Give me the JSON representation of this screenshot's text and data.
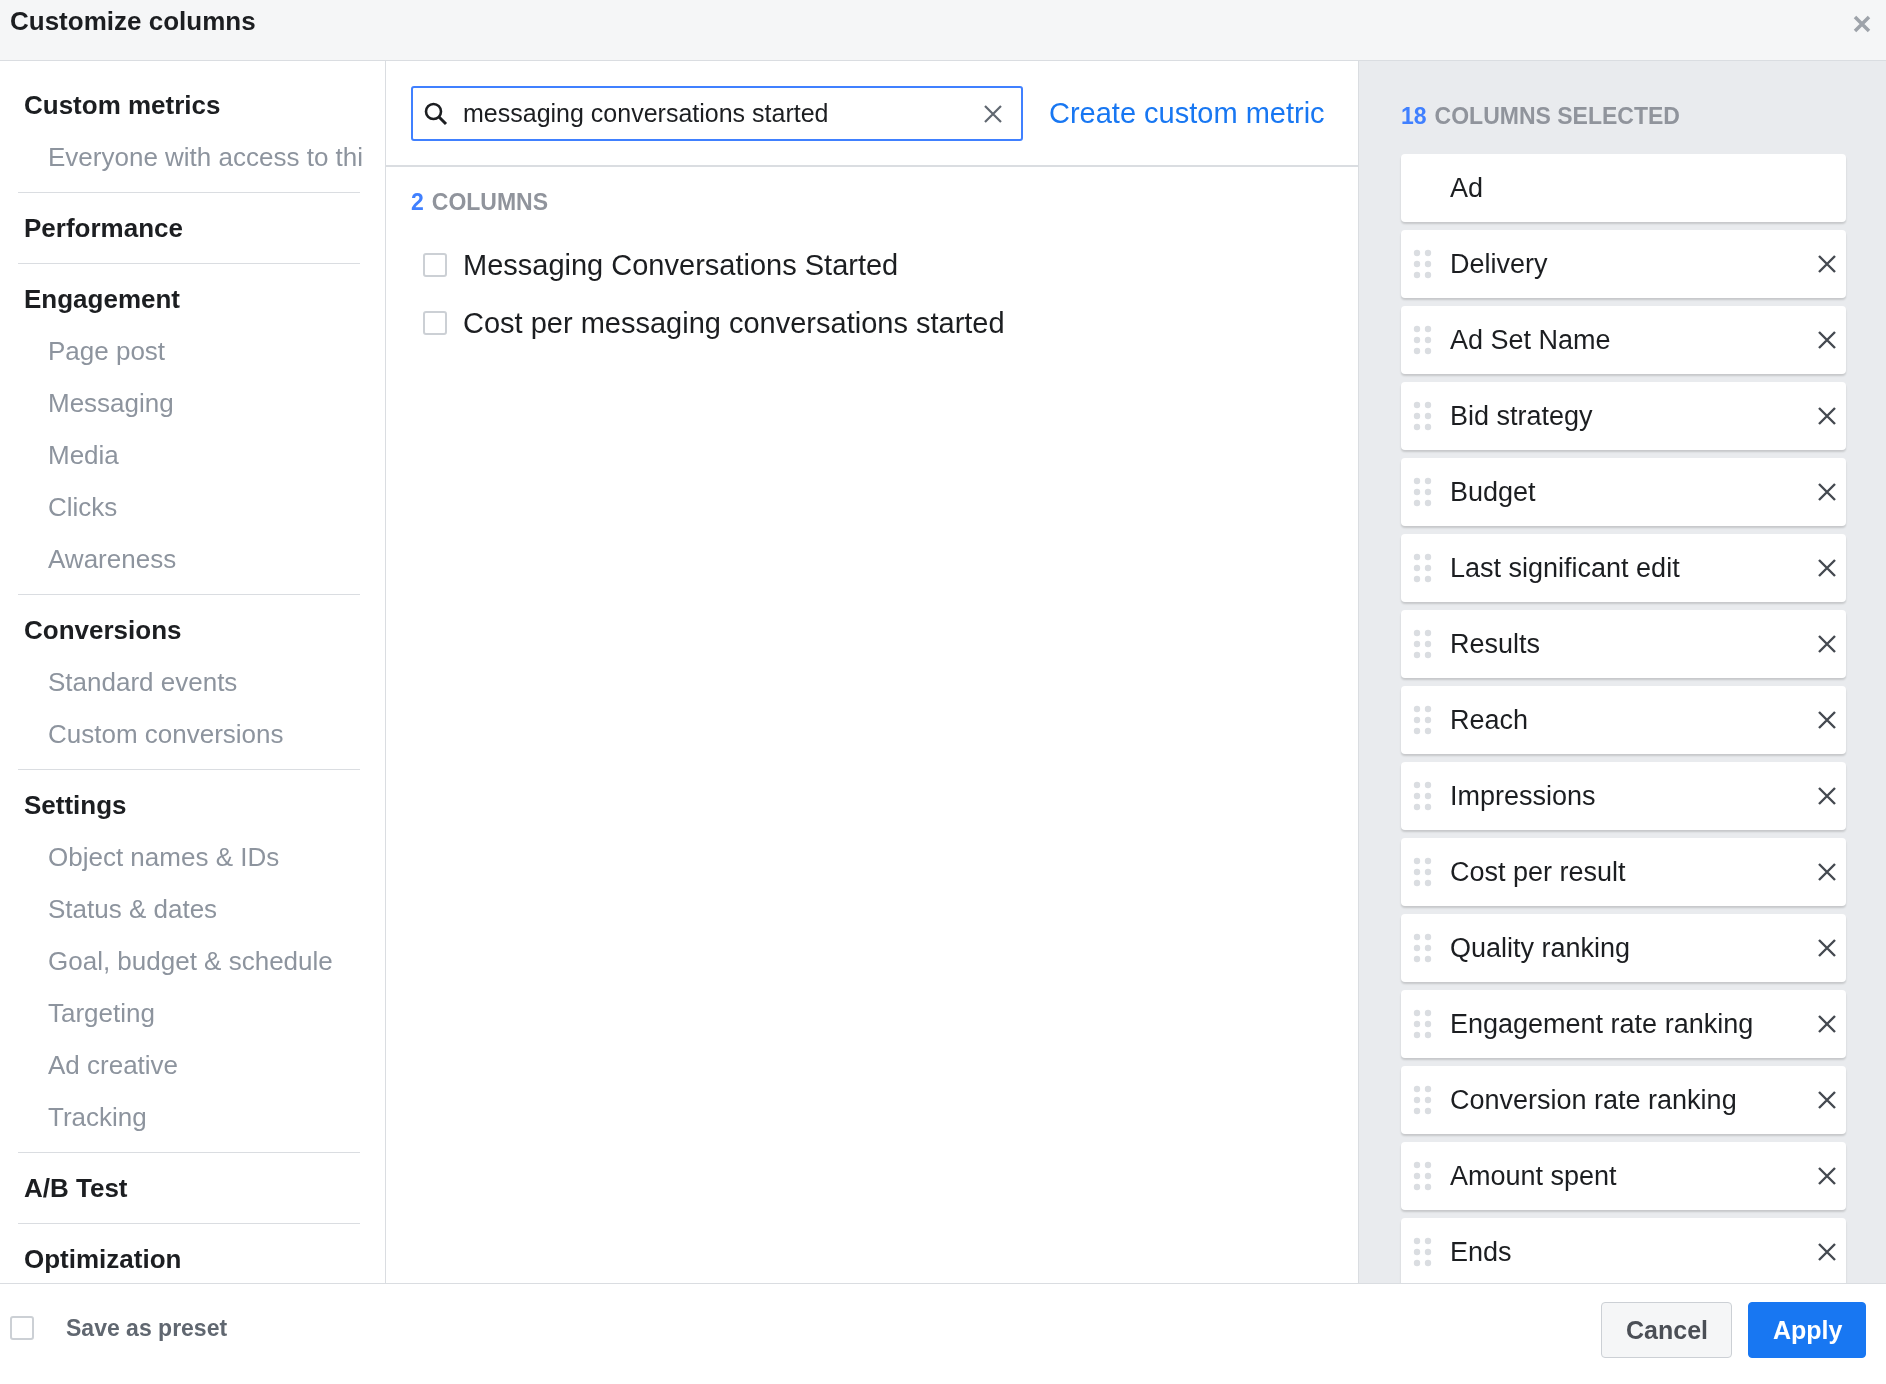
{
  "window": {
    "title": "Customize columns"
  },
  "sidebar": {
    "sections": [
      {
        "title": "Custom metrics",
        "items": [
          "Everyone with access to thi"
        ]
      },
      {
        "title": "Performance"
      },
      {
        "title": "Engagement",
        "items": [
          "Page post",
          "Messaging",
          "Media",
          "Clicks",
          "Awareness"
        ]
      },
      {
        "title": "Conversions",
        "items": [
          "Standard events",
          "Custom conversions"
        ]
      },
      {
        "title": "Settings",
        "items": [
          "Object names & IDs",
          "Status & dates",
          "Goal, budget & schedule",
          "Targeting",
          "Ad creative",
          "Tracking"
        ]
      },
      {
        "title": "A/B Test"
      },
      {
        "title": "Optimization"
      }
    ]
  },
  "search": {
    "value": "messaging conversations started",
    "link": "Create custom metric"
  },
  "results": {
    "count": "2",
    "heading": "COLUMNS",
    "rows": [
      {
        "label": "Messaging Conversations Started",
        "checked": false
      },
      {
        "label": "Cost per messaging conversations started",
        "checked": false
      }
    ]
  },
  "selected": {
    "count": "18",
    "heading": "COLUMNS SELECTED",
    "columns": [
      {
        "label": "Ad",
        "kind": "fixed"
      },
      {
        "label": "Delivery",
        "kind": "movable"
      },
      {
        "label": "Ad Set Name",
        "kind": "movable"
      },
      {
        "label": "Bid strategy",
        "kind": "movable"
      },
      {
        "label": "Budget",
        "kind": "movable"
      },
      {
        "label": "Last significant edit",
        "kind": "movable"
      },
      {
        "label": "Results",
        "kind": "movable"
      },
      {
        "label": "Reach",
        "kind": "movable"
      },
      {
        "label": "Impressions",
        "kind": "movable"
      },
      {
        "label": "Cost per result",
        "kind": "movable"
      },
      {
        "label": "Quality ranking",
        "kind": "movable"
      },
      {
        "label": "Engagement rate ranking",
        "kind": "movable"
      },
      {
        "label": "Conversion rate ranking",
        "kind": "movable"
      },
      {
        "label": "Amount spent",
        "kind": "movable"
      },
      {
        "label": "Ends",
        "kind": "movable"
      }
    ]
  },
  "footer": {
    "save_preset": {
      "label": "Save as preset",
      "checked": false
    },
    "buttons": [
      {
        "label": "Cancel",
        "kind": "secondary"
      },
      {
        "label": "Apply",
        "kind": "primary"
      }
    ]
  }
}
